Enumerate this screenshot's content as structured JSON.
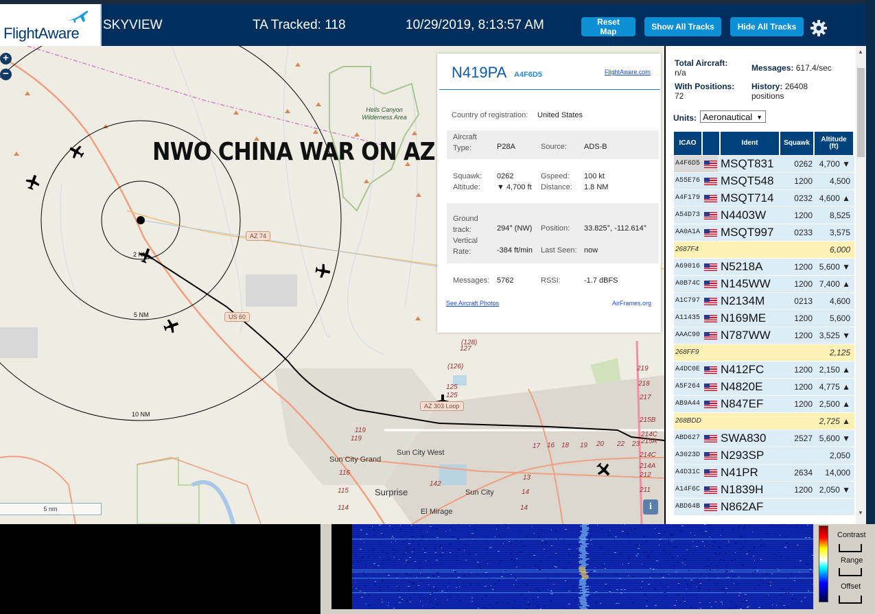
{
  "header": {
    "logo": "FlightAware",
    "app_title": "SKYVIEW",
    "tracked": "TA Tracked: 118",
    "datetime": "10/29/2019, 8:13:57 AM",
    "buttons": {
      "reset": "Reset Map",
      "show_all": "Show All Tracks",
      "hide_all": "Hide All Tracks"
    }
  },
  "map": {
    "zoom_in": "+",
    "zoom_out": "−",
    "overlay_text": "NWO CHINA WAR ON AZ",
    "scale": "5 nm",
    "info": "i",
    "ring_labels": [
      "2 NM",
      "5 NM",
      "10 NM"
    ],
    "area_label": "Hells Canyon Wilderness Area",
    "towns": [
      "Sun City Grand",
      "Sun City West",
      "Surprise",
      "Sun City",
      "El Mirage"
    ],
    "shields": [
      "AZ 74",
      "US 60",
      "AZ 303 Loop"
    ],
    "road_numbers": [
      "(128)",
      "127",
      "(126)",
      "125",
      "125",
      "119",
      "119",
      "116",
      "115",
      "114",
      "142",
      "17",
      "16",
      "18",
      "19",
      "20",
      "22",
      "23",
      "14",
      "14",
      "13",
      "219",
      "218",
      "217",
      "215B",
      "214C",
      "215A",
      "214C",
      "214A",
      "212",
      "211"
    ]
  },
  "popup": {
    "callsign": "N419PA",
    "hex": "A4F6D5",
    "fa_link": "FlightAware.com",
    "country_label": "Country of registration:",
    "country": "United States",
    "aircraft_type_label": "Aircraft Type:",
    "aircraft_type": "P28A",
    "source_label": "Source:",
    "source": "ADS-B",
    "squawk_label": "Squawk:",
    "squawk": "0262",
    "gspeed_label": "Gspeed:",
    "gspeed": "100 kt",
    "altitude_label": "Altitude:",
    "altitude": "▼ 4,700 ft",
    "distance_label": "Distance:",
    "distance": "1.8 NM",
    "ground_track_label": "Ground track:",
    "ground_track": "294° (NW)",
    "position_label": "Position:",
    "position": "33.825°, -112.614°",
    "vertical_rate_label": "Vertical Rate:",
    "vertical_rate": "-384 ft/min",
    "last_seen_label": "Last Seen:",
    "last_seen": "now",
    "messages_label": "Messages:",
    "messages": "5762",
    "rssi_label": "RSSI:",
    "rssi": "-1.7 dBFS",
    "photos_link": "See Aircraft Photos",
    "airframes_link": "AirFrames.org"
  },
  "panel": {
    "total_aircraft_label": "Total Aircraft:",
    "total_aircraft": "n/a",
    "messages_label": "Messages:",
    "messages": "617.4/sec",
    "with_positions_label": "With Positions:",
    "with_positions": "72",
    "history_label": "History:",
    "history": "26408 positions",
    "units_label": "Units:",
    "units": "Aeronautical",
    "columns": [
      "ICAO",
      "",
      "Ident",
      "Squawk",
      "Altitude (ft)"
    ],
    "rows": [
      {
        "icao": "A4F6D5",
        "flag": true,
        "ident": "MSQT831",
        "squawk": "0262",
        "alt": "4,700 ▼",
        "style": "selected"
      },
      {
        "icao": "A55E76",
        "flag": true,
        "ident": "MSQT548",
        "squawk": "1200",
        "alt": "4,500",
        "style": "light"
      },
      {
        "icao": "A4F179",
        "flag": true,
        "ident": "MSQT714",
        "squawk": "0232",
        "alt": "4,600 ▲",
        "style": "light"
      },
      {
        "icao": "A54D73",
        "flag": true,
        "ident": "N4403W",
        "squawk": "1200",
        "alt": "8,525",
        "style": "light"
      },
      {
        "icao": "AA0A1A",
        "flag": true,
        "ident": "MSQT997",
        "squawk": "0233",
        "alt": "3,575",
        "style": "light"
      },
      {
        "icao": "2687F4",
        "flag": false,
        "ident": "",
        "squawk": "",
        "alt": "6,000",
        "style": "noloc"
      },
      {
        "icao": "A69016",
        "flag": true,
        "ident": "N5218A",
        "squawk": "1200",
        "alt": "5,600 ▼",
        "style": "light"
      },
      {
        "icao": "A0B74C",
        "flag": true,
        "ident": "N145WW",
        "squawk": "1200",
        "alt": "7,400 ▲",
        "style": "light"
      },
      {
        "icao": "A1C797",
        "flag": true,
        "ident": "N2134M",
        "squawk": "0213",
        "alt": "4,600",
        "style": "light"
      },
      {
        "icao": "A11435",
        "flag": true,
        "ident": "N169ME",
        "squawk": "1200",
        "alt": "5,600",
        "style": "light"
      },
      {
        "icao": "AAAC90",
        "flag": true,
        "ident": "N787WW",
        "squawk": "1200",
        "alt": "3,525 ▼",
        "style": "light"
      },
      {
        "icao": "268FF9",
        "flag": false,
        "ident": "",
        "squawk": "",
        "alt": "2,125",
        "style": "noloc"
      },
      {
        "icao": "A4DC0E",
        "flag": true,
        "ident": "N412FC",
        "squawk": "1200",
        "alt": "2,150 ▲",
        "style": "light"
      },
      {
        "icao": "A5F264",
        "flag": true,
        "ident": "N4820E",
        "squawk": "1200",
        "alt": "4,775 ▲",
        "style": "light"
      },
      {
        "icao": "AB9A44",
        "flag": true,
        "ident": "N847EF",
        "squawk": "1200",
        "alt": "2,500 ▲",
        "style": "light"
      },
      {
        "icao": "268BDD",
        "flag": false,
        "ident": "",
        "squawk": "",
        "alt": "2,725 ▲",
        "style": "noloc"
      },
      {
        "icao": "ABD627",
        "flag": true,
        "ident": "SWA830",
        "squawk": "2527",
        "alt": "5,600 ▼",
        "style": "light"
      },
      {
        "icao": "A3023D",
        "flag": true,
        "ident": "N293SP",
        "squawk": "",
        "alt": "2,050",
        "style": "light"
      },
      {
        "icao": "A4D31C",
        "flag": true,
        "ident": "N41PR",
        "squawk": "2634",
        "alt": "14,000",
        "style": "light"
      },
      {
        "icao": "A14F6C",
        "flag": true,
        "ident": "N1839H",
        "squawk": "1200",
        "alt": "2,050 ▼",
        "style": "light"
      },
      {
        "icao": "ABD64B",
        "flag": true,
        "ident": "N862AF",
        "squawk": "",
        "alt": "",
        "style": "light"
      }
    ]
  },
  "waterfall": {
    "contrast": "Contrast",
    "range": "Range",
    "offset": "Offset"
  },
  "colors": {
    "header": "#002f5d",
    "button": "#0d8fd6",
    "table_header": "#00437c",
    "row_light": "#dcedf8",
    "row_noloc": "#fcf0b4"
  }
}
